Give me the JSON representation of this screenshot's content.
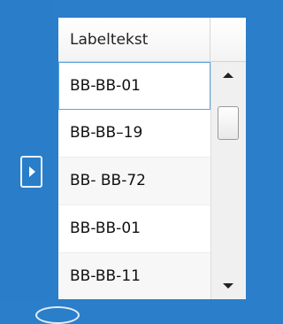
{
  "column_header": "Labeltekst",
  "rows": [
    {
      "label": "BB-BB-01"
    },
    {
      "label": "BB-BB–19"
    },
    {
      "label": "BB- BB-72"
    },
    {
      "label": "BB-BB-01"
    },
    {
      "label": "BB-BB-11"
    }
  ],
  "selected_index": 0,
  "icons": {
    "expand": "chevron-right-icon",
    "scroll_up": "arrow-up-icon",
    "scroll_down": "arrow-down-icon"
  },
  "colors": {
    "background": "#2b7ec9",
    "selection_border": "#5ca4dd"
  }
}
